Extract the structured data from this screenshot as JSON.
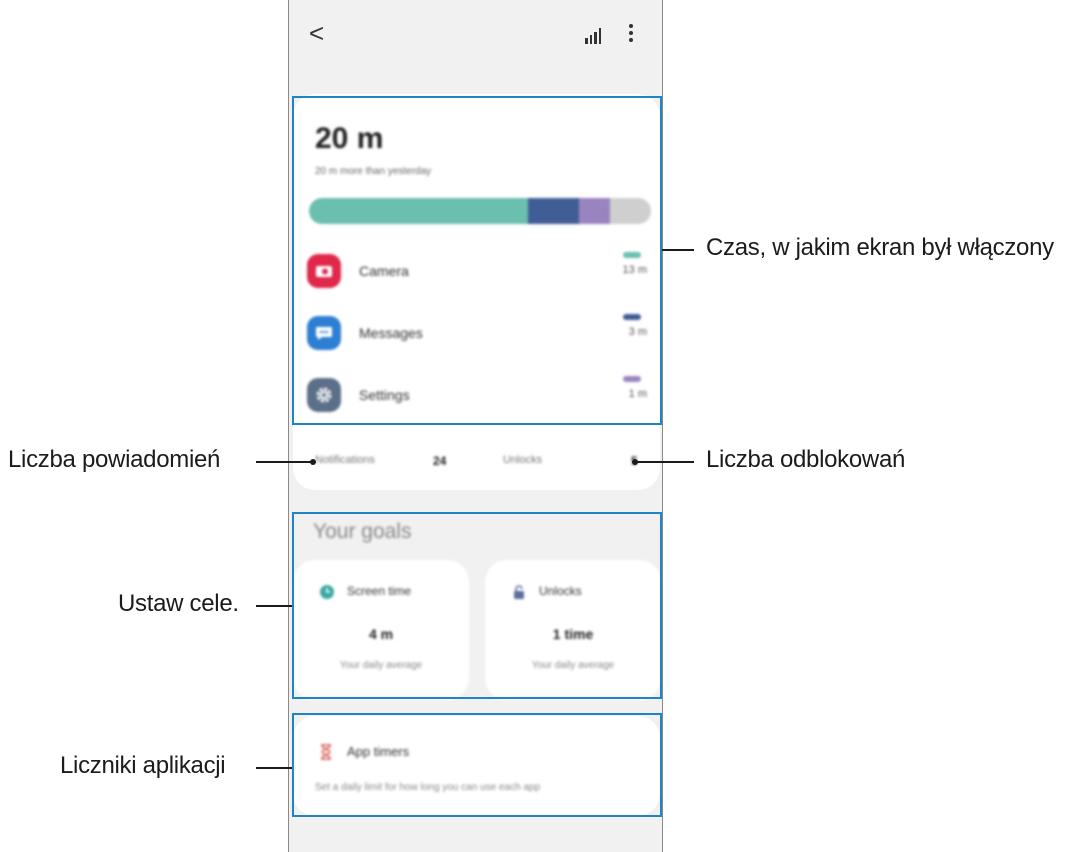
{
  "header": {
    "back_label": "<"
  },
  "summary": {
    "total_time": "20 m",
    "comparison": "20 m more than yesterday",
    "bar_segments": [
      {
        "app": "Camera",
        "fraction": 0.64,
        "color": "#6bbfae"
      },
      {
        "app": "Messages",
        "fraction": 0.15,
        "color": "#415d96"
      },
      {
        "app": "Settings",
        "fraction": 0.09,
        "color": "#9a84c0"
      },
      {
        "app": "Other",
        "fraction": 0.12,
        "color": "#cfcfcf"
      }
    ],
    "apps": [
      {
        "name": "Camera",
        "time": "13 m",
        "icon": "camera-icon",
        "icon_color": "#e0284b",
        "mini_color": "#6bbfae"
      },
      {
        "name": "Messages",
        "time": "3 m",
        "icon": "chat-bubble-icon",
        "icon_color": "#2d7fd3",
        "mini_color": "#415d96"
      },
      {
        "name": "Settings",
        "time": "1 m",
        "icon": "gear-icon",
        "icon_color": "#5b6f88",
        "mini_color": "#9a84c0"
      }
    ],
    "notifications_label": "Notifications",
    "notifications_value": "24",
    "unlocks_label": "Unlocks",
    "unlocks_value": "5"
  },
  "goals": {
    "title": "Your goals",
    "screen_time": {
      "label": "Screen time",
      "value": "4 m",
      "sub": "Your daily average"
    },
    "unlocks": {
      "label": "Unlocks",
      "value": "1 time",
      "sub": "Your daily average"
    }
  },
  "app_timers": {
    "title": "App timers",
    "subtitle": "Set a daily limit for how long you can use each app"
  },
  "callouts": {
    "screen_time": "Czas, w jakim ekran był włączony",
    "notifications": "Liczba powiadomień",
    "unlocks": "Liczba odblokowań",
    "goals": "Ustaw cele.",
    "timers": "Liczniki aplikacji"
  },
  "colors": {
    "highlight": "#1b86c3",
    "accent_teal": "#3aa9a0"
  }
}
